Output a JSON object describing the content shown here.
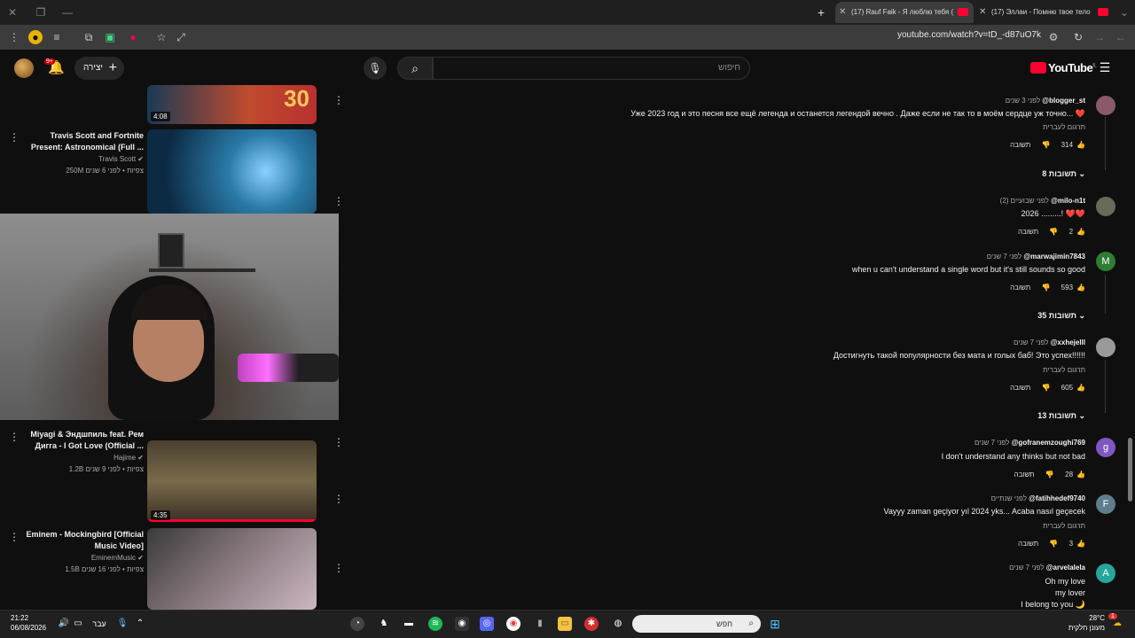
{
  "browser": {
    "tabs": [
      {
        "label": "(17) Rauf Faik - Я люблю тебя (",
        "active": true
      },
      {
        "label": "(17) Эллаи - Помню твое тело",
        "active": false
      }
    ],
    "new_tab": "+",
    "url": "youtube.com/watch?v=tD_-d87uO7k"
  },
  "header": {
    "logo": "YouTube",
    "logo_region": "IL",
    "search_placeholder": "חיפוש",
    "create_label": "יצירה",
    "notifications_badge": "9+"
  },
  "videos": [
    {
      "title": "",
      "channel": "",
      "meta": "",
      "duration": "4:08"
    },
    {
      "title": "Travis Scott and Fortnite Present: Astronomical (Full ...",
      "channel": "Travis Scott",
      "meta": "250M צפיות • לפני 6 שנים",
      "duration": ""
    },
    {
      "title": "Miyagi & Эндшпиль feat. Рем Дигга - I Got Love (Official ...",
      "channel": "Hajime",
      "meta": "1.2B צפיות • לפני 9 שנים",
      "duration": "4:35"
    },
    {
      "title": "Eminem - Mockingbird [Official Music Video]",
      "channel": "EminemMusic",
      "meta": "1.5B צפיות • לפני 16 שנים",
      "duration": ""
    }
  ],
  "comments": [
    {
      "author": "@blogger_st",
      "time": "לפני 3 שנים",
      "text": "Уже 2023 год и это песня все ещё легенда и останется легендой вечно . Даже если не так то в моём сердце уж точно... ❤️",
      "translate": "תרגום לעברית",
      "likes": "314",
      "reply": "תשובה",
      "replies": "8 תשובות",
      "avatar_color": "#8a5a6a",
      "avatar_letter": ""
    },
    {
      "author": "@milo-n1t",
      "time": "לפני שבועיים (2)",
      "text": "2026 .........! ❤️❤️",
      "translate": "",
      "likes": "2",
      "reply": "תשובה",
      "replies": "",
      "avatar_color": "#6a6a5a",
      "avatar_letter": ""
    },
    {
      "author": "@marwajimin7843",
      "time": "לפני 7 שנים",
      "text": "when u can't understand a single word but it's still sounds so good",
      "translate": "",
      "likes": "593",
      "reply": "תשובה",
      "replies": "35 תשובות",
      "avatar_color": "#2e7d32",
      "avatar_letter": "M"
    },
    {
      "author": "@xxhejelll",
      "time": "לפני 7 שנים",
      "text": "Достигнуть такой популярности без мата и голых баб! Это успех!!!!!!",
      "translate": "תרגום לעברית",
      "likes": "605",
      "reply": "תשובה",
      "replies": "13 תשובות",
      "avatar_color": "#9a9a9a",
      "avatar_letter": ""
    },
    {
      "author": "@gofranemzoughi769",
      "time": "לפני 7 שנים",
      "text": "I don't understand any thinks but not bad",
      "translate": "",
      "likes": "28",
      "reply": "תשובה",
      "replies": "",
      "avatar_color": "#7e57c2",
      "avatar_letter": "g"
    },
    {
      "author": "@fatihhedef9740",
      "time": "לפני שנתיים",
      "text": "Vayyy zaman geçiyor yıl 2024 yks... Acaba nasıl geçecek",
      "translate": "תרגום לעברית",
      "likes": "3",
      "reply": "תשובה",
      "replies": "",
      "avatar_color": "#607d8b",
      "avatar_letter": "F"
    },
    {
      "author": "@arvelalela",
      "time": "לפני 7 שנים",
      "text_lines": [
        "Oh my love",
        "my lover",
        "I belong to you 🌙"
      ],
      "avatar_color": "#26a69a",
      "avatar_letter": "A"
    }
  ],
  "taskbar": {
    "time": "21:22",
    "date": "06/08/2026",
    "lang": "עבר",
    "search_placeholder": "חפש",
    "temp": "28°C",
    "weather": "מעונן חלקית",
    "weather_badge": "1"
  }
}
